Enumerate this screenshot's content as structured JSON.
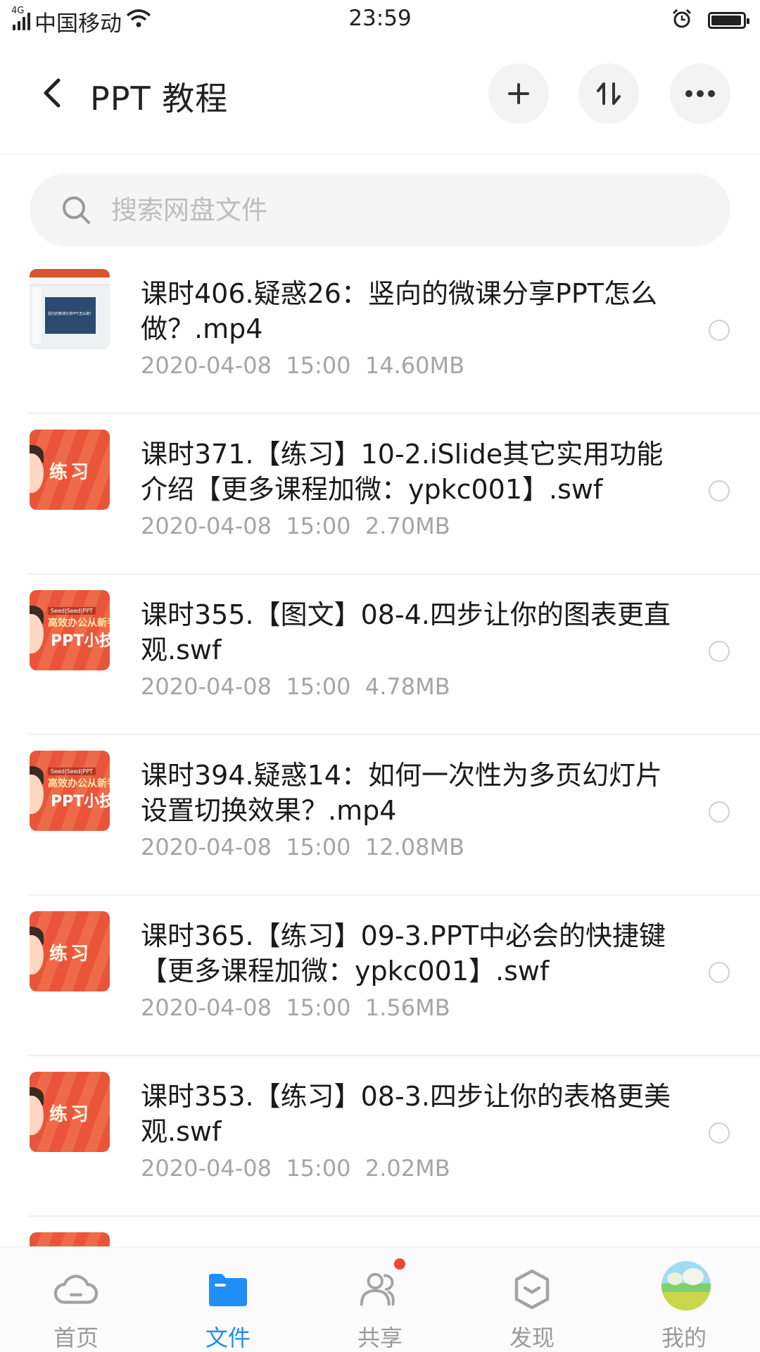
{
  "status_bar": {
    "network": "4G",
    "carrier": "中国移动",
    "time": "23:59",
    "battery_level": 0.95,
    "icons": [
      "signal-icon",
      "wifi-icon",
      "alarm-icon",
      "battery-icon"
    ]
  },
  "header": {
    "title": "PPT 教程",
    "icons": [
      "back-icon",
      "add-icon",
      "sort-icon",
      "more-icon"
    ]
  },
  "search": {
    "placeholder": "搜索网盘文件",
    "value": ""
  },
  "files": [
    {
      "name": "课时406.疑惑26：竖向的微课分享PPT怎么做？.mp4",
      "date": "2020-04-08",
      "time": "15:00",
      "size": "14.60MB",
      "thumb": "screen"
    },
    {
      "name": "课时371.【练习】10-2.iSlide其它实用功能介绍【更多课程加微：ypkc001】.swf",
      "date": "2020-04-08",
      "time": "15:00",
      "size": "2.70MB",
      "thumb": "practice"
    },
    {
      "name": "课时355.【图文】08-4.四步让你的图表更直观.swf",
      "date": "2020-04-08",
      "time": "15:00",
      "size": "4.78MB",
      "thumb": "ppt"
    },
    {
      "name": "课时394.疑惑14：如何一次性为多页幻灯片设置切换效果？.mp4",
      "date": "2020-04-08",
      "time": "15:00",
      "size": "12.08MB",
      "thumb": "ppt"
    },
    {
      "name": "课时365.【练习】09-3.PPT中必会的快捷键【更多课程加微：ypkc001】.swf",
      "date": "2020-04-08",
      "time": "15:00",
      "size": "1.56MB",
      "thumb": "practice"
    },
    {
      "name": "课时353.【练习】08-3.四步让你的表格更美观.swf",
      "date": "2020-04-08",
      "time": "15:00",
      "size": "2.02MB",
      "thumb": "practice"
    }
  ],
  "bottom_nav": {
    "items": [
      {
        "label": "首页",
        "icon": "cloud-icon",
        "active": false
      },
      {
        "label": "文件",
        "icon": "folder-icon",
        "active": true
      },
      {
        "label": "共享",
        "icon": "share-people-icon",
        "active": false,
        "badge": true
      },
      {
        "label": "发现",
        "icon": "discover-icon",
        "active": false
      },
      {
        "label": "我的",
        "icon": "avatar",
        "active": false
      }
    ]
  },
  "colors": {
    "accent": "#1f8ef7",
    "badge": "#f0443a",
    "meta_text": "#a5a5a5",
    "thumb_orange": "#e8553a"
  },
  "thumb_text": {
    "practice": "练习",
    "tag": "Seed|Seed|PPT",
    "sub": "高效办公从新手到",
    "big": "PPT小技",
    "screen_slide": "竖向的微课分享PPT怎么做？"
  }
}
